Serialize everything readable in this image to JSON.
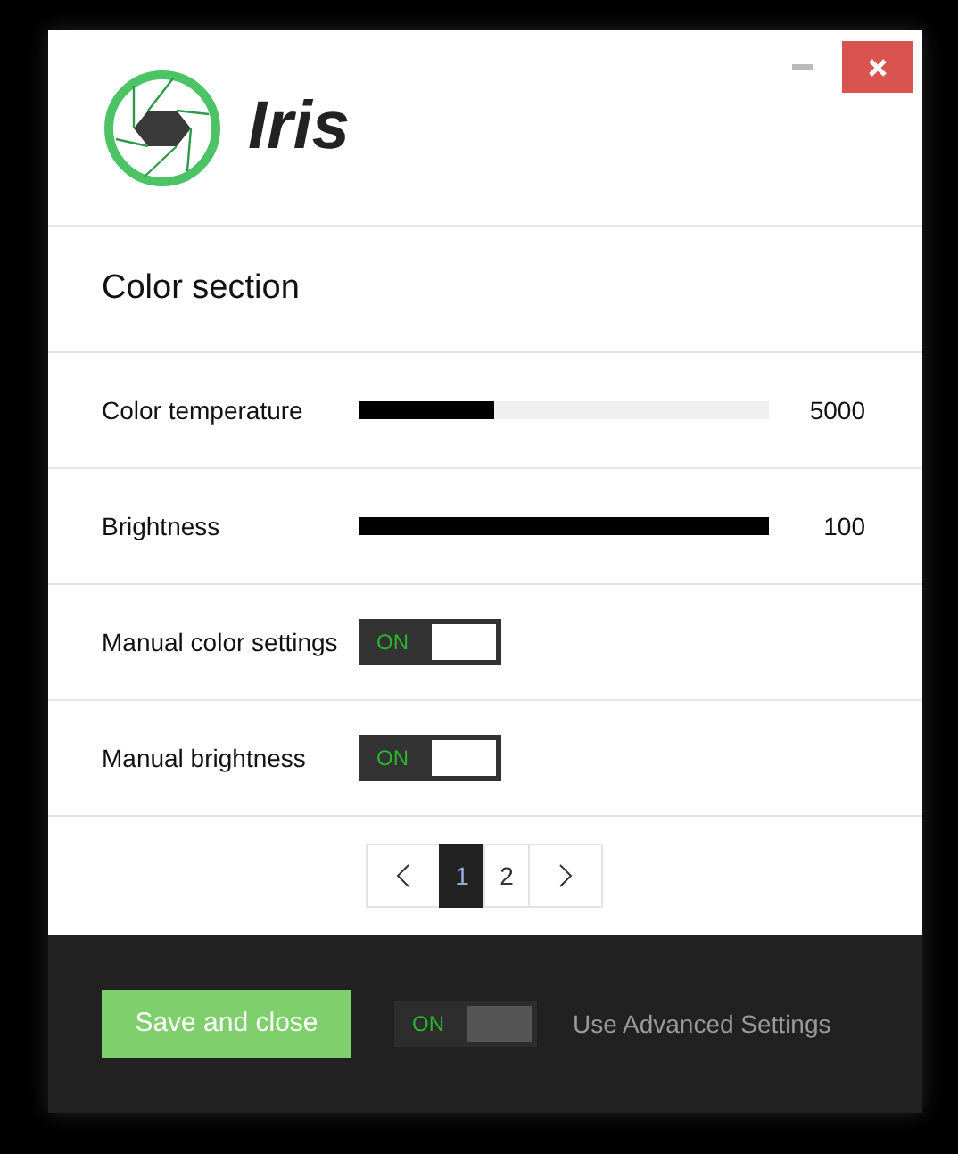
{
  "window": {
    "title": "Iris",
    "minimize_button": true,
    "close_button": true
  },
  "section": {
    "title": "Color section"
  },
  "rows": [
    {
      "kind": "slider",
      "label": "Color temperature",
      "level": 0.33,
      "reading": "5000"
    },
    {
      "kind": "slider",
      "label": "Brightness",
      "level": 1.0,
      "reading": "100"
    },
    {
      "kind": "switch",
      "label": "Manual color settings",
      "on": true,
      "state_label": "ON"
    },
    {
      "kind": "switch",
      "label": "Manual brightness",
      "on": true,
      "state_label": "ON"
    }
  ],
  "pagination": {
    "pages": [
      {
        "label": "1",
        "selected": true
      },
      {
        "label": "2",
        "selected": false
      }
    ]
  },
  "footer": {
    "button": "Save and close",
    "switch": {
      "on": true,
      "state_label": "ON"
    },
    "switch_label": "Use Advanced Settings"
  }
}
